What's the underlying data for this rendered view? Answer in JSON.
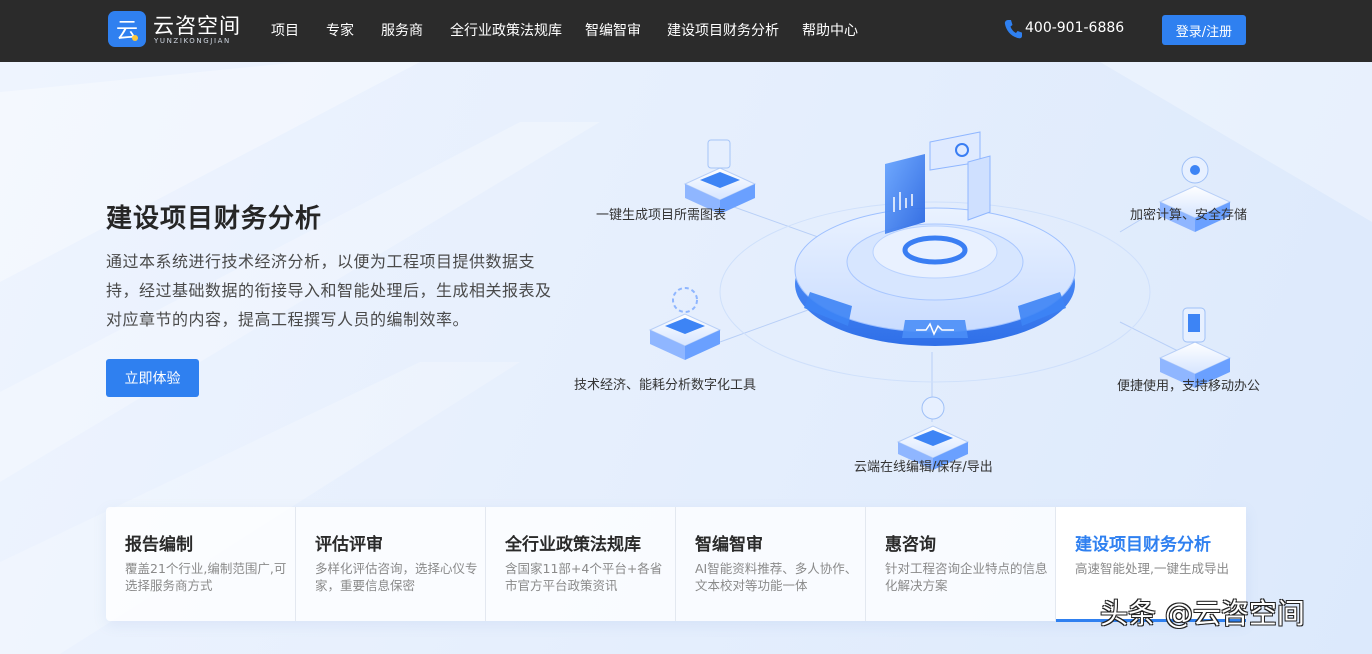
{
  "brand": {
    "name": "云咨空间",
    "sub": "YUNZIKONGJIAN",
    "logo_glyph": "云",
    "accent": "#2f80f0"
  },
  "nav": {
    "items": [
      {
        "label": "项目"
      },
      {
        "label": "专家"
      },
      {
        "label": "服务商"
      },
      {
        "label": "全行业政策法规库"
      },
      {
        "label": "智编智审"
      },
      {
        "label": "建设项目财务分析"
      },
      {
        "label": "帮助中心"
      }
    ],
    "phone": "400-901-6886",
    "login_label": "登录/注册"
  },
  "hero": {
    "title": "建设项目财务分析",
    "description": "通过本系统进行技术经济分析，以便为工程项目提供数据支持，经过基础数据的衔接导入和智能处理后，生成相关报表及对应章节的内容，提高工程撰写人员的编制效率。",
    "cta_label": "立即体验"
  },
  "features": {
    "chart_gen": "一键生成项目所需图表",
    "encryption": "加密计算、安全存储",
    "tools": "技术经济、能耗分析数字化工具",
    "mobile": "便捷使用，支持移动办公",
    "cloud": "云端在线编辑/保存/导出"
  },
  "cards": [
    {
      "title": "报告编制",
      "desc": "覆盖21个行业,编制范围广,可选择服务商方式"
    },
    {
      "title": "评估评审",
      "desc": "多样化评估咨询，选择心仪专家，重要信息保密"
    },
    {
      "title": "全行业政策法规库",
      "desc": "含国家11部+4个平台+各省市官方平台政策资讯"
    },
    {
      "title": "智编智审",
      "desc": "AI智能资料推荐、多人协作、文本校对等功能一体"
    },
    {
      "title": "惠咨询",
      "desc": "针对工程咨询企业特点的信息化解决方案"
    },
    {
      "title": "建设项目财务分析",
      "desc": "高速智能处理,一键生成导出"
    }
  ],
  "watermark": "头条 @云咨空间"
}
